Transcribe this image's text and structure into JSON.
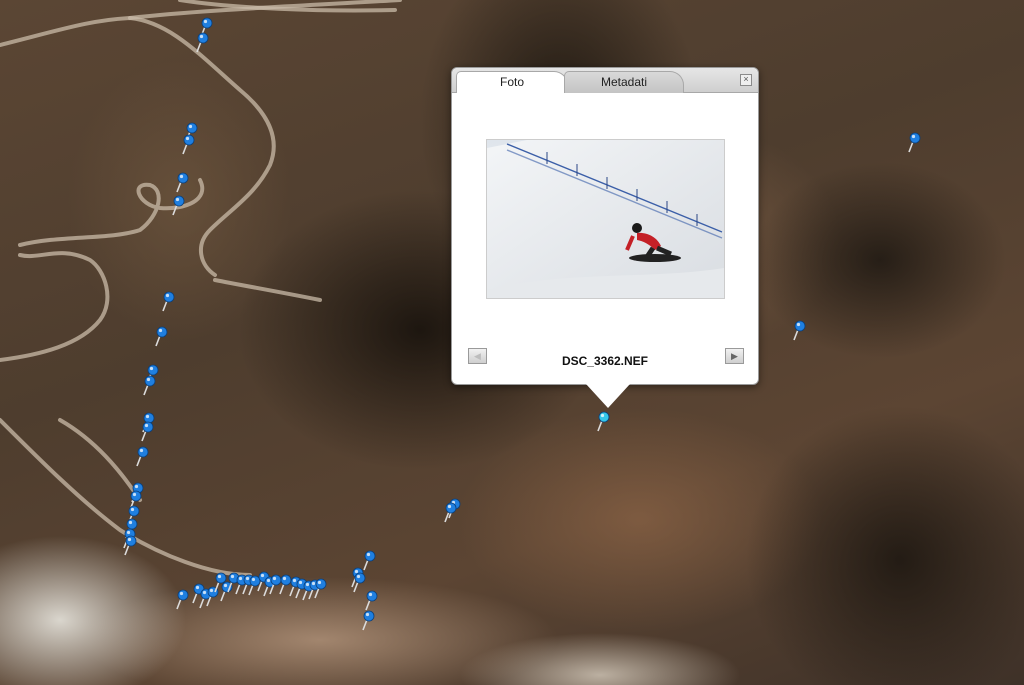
{
  "popup": {
    "tabs": [
      {
        "label": "Foto",
        "active": true
      },
      {
        "label": "Metadati",
        "active": false
      }
    ],
    "filename": "DSC_3362.NEF",
    "close_icon": "close-icon",
    "prev_icon": "prev-arrow-icon",
    "next_icon": "next-arrow-icon"
  },
  "map": {
    "pin_color": "#1f7fe0",
    "selected_pin_color": "#35c6e8"
  }
}
